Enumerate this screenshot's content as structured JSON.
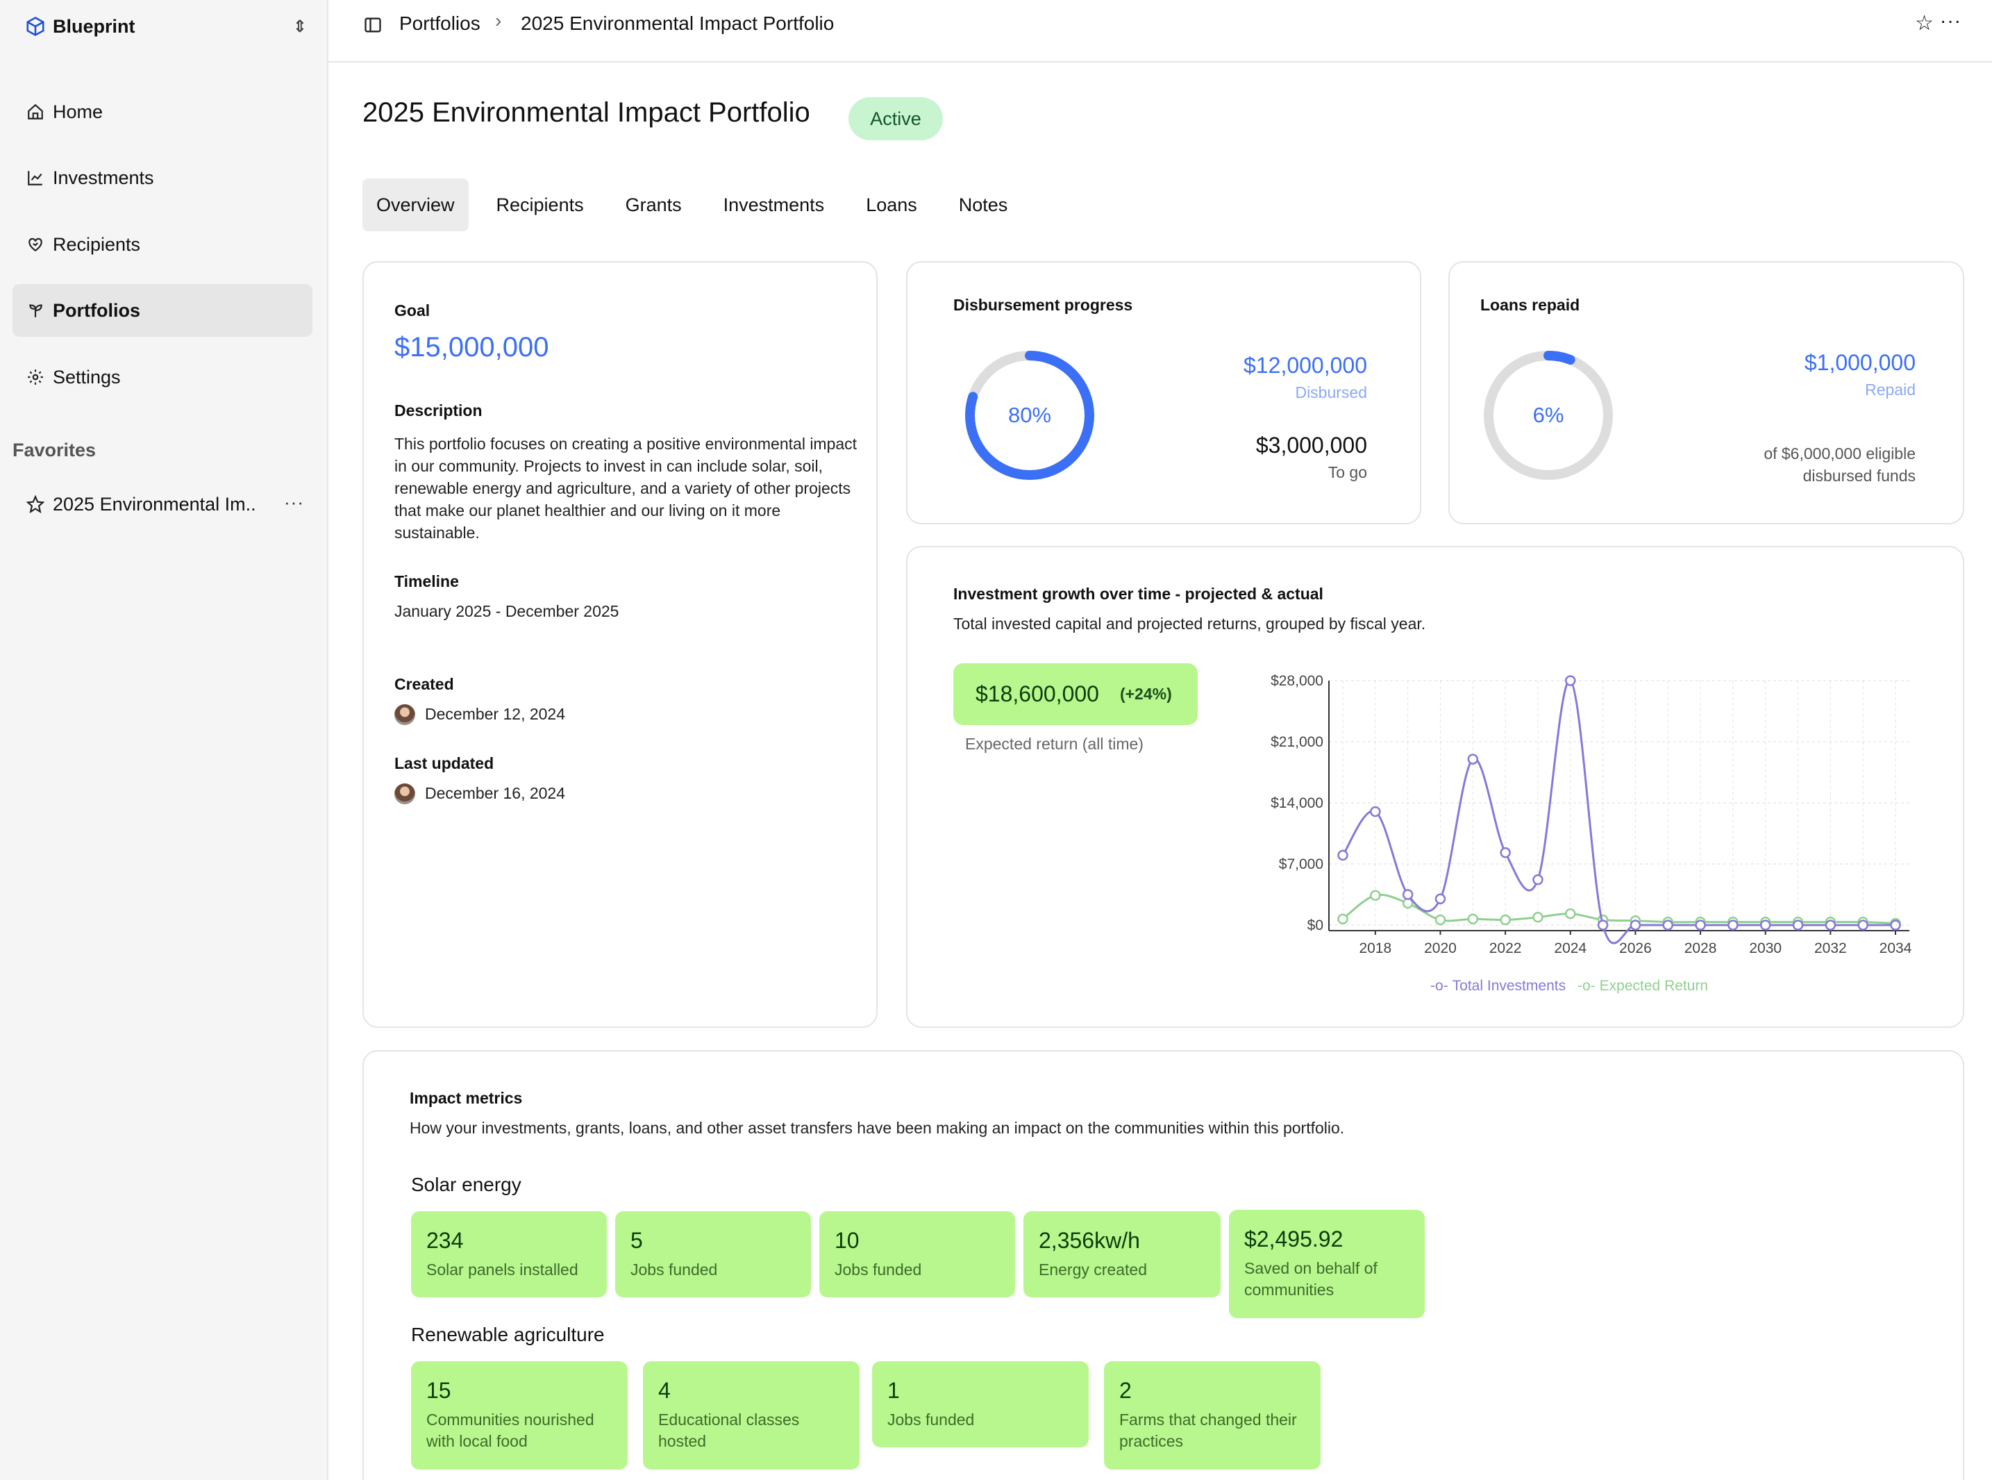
{
  "sidebar": {
    "brand": "Blueprint",
    "nav": [
      {
        "label": "Home",
        "icon": "home-icon"
      },
      {
        "label": "Investments",
        "icon": "chart-line-icon"
      },
      {
        "label": "Recipients",
        "icon": "heart-handshake-icon"
      },
      {
        "label": "Portfolios",
        "icon": "sprout-icon",
        "active": true
      },
      {
        "label": "Settings",
        "icon": "gear-icon"
      }
    ],
    "favorites_heading": "Favorites",
    "favorites": [
      {
        "label": "2025 Environmental Im..",
        "icon": "star-icon"
      }
    ]
  },
  "topbar": {
    "crumb_parent": "Portfolios",
    "crumb_current": "2025 Environmental Impact Portfolio"
  },
  "page": {
    "title": "2025 Environmental Impact Portfolio",
    "status": "Active",
    "tabs": [
      "Overview",
      "Recipients",
      "Grants",
      "Investments",
      "Loans",
      "Notes"
    ],
    "active_tab": "Overview"
  },
  "overview": {
    "goal_label": "Goal",
    "goal_value": "$15,000,000",
    "description_label": "Description",
    "description": "This portfolio focuses on creating a positive environmental impact in our community. Projects to invest in can include solar, soil, renewable energy and agriculture, and a variety of other projects that make our planet healthier and our living on it more sustainable.",
    "timeline_label": "Timeline",
    "timeline": "January 2025 - December 2025",
    "created_label": "Created",
    "created": "December 12, 2024",
    "updated_label": "Last updated",
    "updated": "December 16, 2024"
  },
  "disbursement": {
    "title": "Disbursement progress",
    "percent_label": "80%",
    "progress": 0.8,
    "disbursed_value": "$12,000,000",
    "disbursed_label": "Disbursed",
    "togo_value": "$3,000,000",
    "togo_label": "To go"
  },
  "loans": {
    "title": "Loans repaid",
    "percent_label": "6%",
    "progress": 0.06,
    "repaid_value": "$1,000,000",
    "repaid_label": "Repaid",
    "note_line1": "of $6,000,000 eligible",
    "note_line2": "disbursed funds"
  },
  "growth": {
    "title": "Investment growth over time - projected & actual",
    "subtitle": "Total invested capital and projected returns, grouped by fiscal year.",
    "kpi_value": "$18,600,000",
    "kpi_change": "(+24%)",
    "kpi_label": "Expected return (all time)"
  },
  "chart_data": {
    "type": "line",
    "x": [
      2017,
      2018,
      2019,
      2020,
      2021,
      2022,
      2023,
      2024,
      2025,
      2026,
      2027,
      2028,
      2029,
      2030,
      2031,
      2032,
      2033,
      2034
    ],
    "x_ticks": [
      "2018",
      "2020",
      "2022",
      "2024",
      "2026",
      "2028",
      "2030",
      "2032",
      "2034"
    ],
    "y_ticks": [
      "$0",
      "$7,000",
      "$14,000",
      "$21,000",
      "$28,000"
    ],
    "ylim": [
      0,
      28000
    ],
    "series": [
      {
        "name": "Total Investments",
        "color": "#8878d6",
        "values": [
          8000,
          13000,
          3500,
          3000,
          19000,
          8300,
          5200,
          28000,
          0,
          0,
          0,
          0,
          0,
          0,
          0,
          0,
          0,
          0
        ]
      },
      {
        "name": "Expected Return",
        "color": "#8fd08f",
        "values": [
          700,
          3400,
          2500,
          600,
          700,
          600,
          900,
          1300,
          600,
          500,
          350,
          350,
          350,
          350,
          350,
          350,
          350,
          200
        ]
      }
    ],
    "grid": true,
    "legend": "bottom-center"
  },
  "impact": {
    "title": "Impact metrics",
    "subtitle": "How your investments, grants, loans, and other asset transfers have been making an impact on the communities within this portfolio.",
    "sections": [
      {
        "title": "Solar energy",
        "metrics": [
          {
            "value": "234",
            "label": "Solar panels installed"
          },
          {
            "value": "5",
            "label": "Jobs funded"
          },
          {
            "value": "10",
            "label": "Jobs funded"
          },
          {
            "value": "2,356kw/h",
            "label": "Energy created"
          },
          {
            "value": "$2,495.92",
            "label": "Saved on behalf of communities"
          }
        ]
      },
      {
        "title": "Renewable agriculture",
        "metrics": [
          {
            "value": "15",
            "label": "Communities nourished with local food"
          },
          {
            "value": "4",
            "label": "Educational classes hosted"
          },
          {
            "value": "1",
            "label": "Jobs funded"
          },
          {
            "value": "2",
            "label": "Farms that changed their practices"
          }
        ]
      }
    ]
  }
}
